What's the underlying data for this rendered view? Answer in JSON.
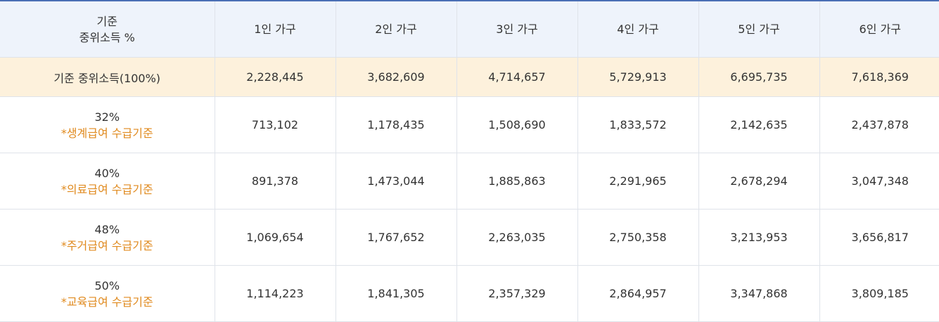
{
  "header": {
    "corner_line1": "기준",
    "corner_line2": "중위소득 %",
    "columns": [
      "1인 가구",
      "2인 가구",
      "3인 가구",
      "4인 가구",
      "5인 가구",
      "6인 가구"
    ]
  },
  "base_row": {
    "label": "기준 중위소득(100%)",
    "values": [
      "2,228,445",
      "3,682,609",
      "4,714,657",
      "5,729,913",
      "6,695,735",
      "7,618,369"
    ]
  },
  "rows": [
    {
      "percent": "32%",
      "note": "*생계급여 수급기준",
      "values": [
        "713,102",
        "1,178,435",
        "1,508,690",
        "1,833,572",
        "2,142,635",
        "2,437,878"
      ]
    },
    {
      "percent": "40%",
      "note": "*의료급여 수급기준",
      "values": [
        "891,378",
        "1,473,044",
        "1,885,863",
        "2,291,965",
        "2,678,294",
        "3,047,348"
      ]
    },
    {
      "percent": "48%",
      "note": "*주거급여 수급기준",
      "values": [
        "1,069,654",
        "1,767,652",
        "2,263,035",
        "2,750,358",
        "3,213,953",
        "3,656,817"
      ]
    },
    {
      "percent": "50%",
      "note": "*교육급여 수급기준",
      "values": [
        "1,114,223",
        "1,841,305",
        "2,357,329",
        "2,864,957",
        "3,347,868",
        "3,809,185"
      ]
    }
  ],
  "colors": {
    "header_bg": "#eef3fb",
    "base_row_bg": "#fdf1dc",
    "note_text": "#e08a1e",
    "top_border": "#4a6fb5"
  }
}
